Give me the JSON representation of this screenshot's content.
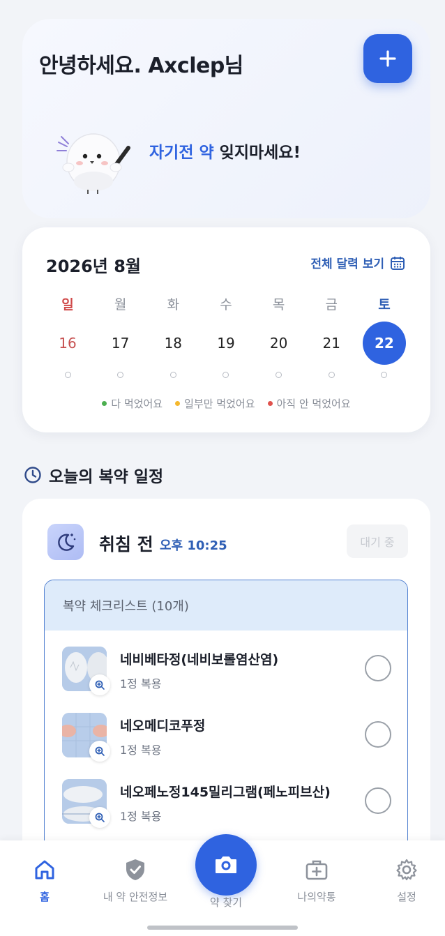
{
  "greeting": {
    "title": "안녕하세요. Axclep님",
    "message_highlight": "자기전 약",
    "message_rest": " 잊지마세요!",
    "add_button_icon": "plus-icon"
  },
  "calendar": {
    "title": "2026년 8월",
    "view_all_label": "전체 달력 보기",
    "weekdays": [
      "일",
      "월",
      "화",
      "수",
      "목",
      "금",
      "토"
    ],
    "days": [
      "16",
      "17",
      "18",
      "19",
      "20",
      "21",
      "22"
    ],
    "selected_day": "22",
    "legend": [
      {
        "label": "다 먹었어요",
        "color": "#4caf50"
      },
      {
        "label": "일부만 먹었어요",
        "color": "#f5b82e"
      },
      {
        "label": "아직 안 먹었어요",
        "color": "#e0524d"
      }
    ]
  },
  "schedule": {
    "section_title": "오늘의 복약 일정",
    "slot_title": "취침 전",
    "slot_time": "오후 10:25",
    "status": "대기 중",
    "checklist_title": "복약 체크리스트 (10개)",
    "medications": [
      {
        "name": "네비베타정(네비보롤염산염)",
        "dose": "1정 복용"
      },
      {
        "name": "네오메디코푸정",
        "dose": "1정 복용"
      },
      {
        "name": "네오페노정145밀리그램(페노피브산)",
        "dose": "1정 복용"
      },
      {
        "name": "",
        "dose": ""
      }
    ]
  },
  "nav": {
    "items": [
      {
        "label": "홈",
        "icon": "home-icon"
      },
      {
        "label": "내 약 안전정보",
        "icon": "shield-check-icon"
      },
      {
        "label": "약 찾기",
        "icon": "camera-icon"
      },
      {
        "label": "나의약통",
        "icon": "medical-box-icon"
      },
      {
        "label": "설정",
        "icon": "gear-icon"
      }
    ],
    "active": "홈"
  },
  "colors": {
    "accent": "#2f63e0",
    "link": "#2f5fb5",
    "sunday": "#d04a4a"
  }
}
